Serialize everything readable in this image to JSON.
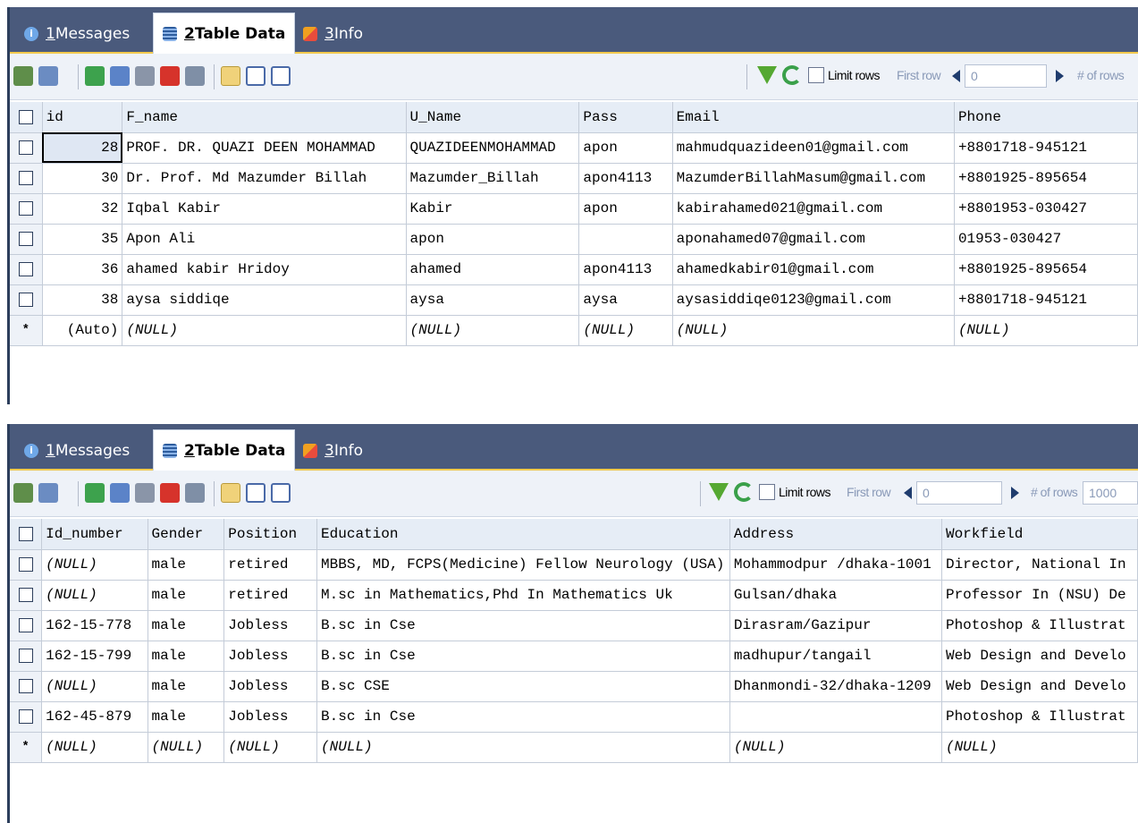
{
  "tabs": {
    "messages": {
      "num": "1",
      "label": " Messages"
    },
    "table_data": {
      "num": "2",
      "label": " Table Data"
    },
    "info": {
      "num": "3",
      "label": " Info"
    }
  },
  "toolbar": {
    "limit_rows_label": "Limit rows",
    "first_row_label": "First row",
    "first_row_value": "0",
    "num_rows_label": "# of rows",
    "num_rows_value": "1000"
  },
  "grid1": {
    "headers": [
      "id",
      "F_name",
      "U_Name",
      "Pass",
      "Email",
      "Phone"
    ],
    "rows": [
      [
        "28",
        "PROF. DR. QUAZI DEEN MOHAMMAD",
        "QUAZIDEENMOHAMMAD",
        "apon",
        "mahmudquazideen01@gmail.com",
        "+8801718-945121"
      ],
      [
        "30",
        "Dr. Prof. Md Mazumder Billah",
        "Mazumder_Billah",
        "apon4113",
        "MazumderBillahMasum@gmail.com",
        "+8801925-895654"
      ],
      [
        "32",
        "Iqbal Kabir",
        "Kabir",
        "apon",
        "kabirahamed021@gmail.com",
        "+8801953-030427"
      ],
      [
        "35",
        "Apon Ali",
        "apon",
        "",
        "aponahamed07@gmail.com",
        "01953-030427"
      ],
      [
        "36",
        "ahamed kabir Hridoy",
        "ahamed",
        "apon4113",
        "ahamedkabir01@gmail.com",
        "+8801925-895654"
      ],
      [
        "38",
        "aysa siddiqe",
        "aysa",
        "aysa",
        "aysasiddiqe0123@gmail.com",
        "+8801718-945121"
      ]
    ],
    "new_row": [
      "(Auto)",
      "(NULL)",
      "(NULL)",
      "(NULL)",
      "(NULL)",
      "(NULL)"
    ]
  },
  "grid2": {
    "headers": [
      "Id_number",
      "Gender",
      "Position",
      "Education",
      "Address",
      "Workfield"
    ],
    "rows": [
      [
        "(NULL)",
        "male",
        "retired",
        "MBBS, MD, FCPS(Medicine) Fellow Neurology (USA)",
        "Mohammodpur /dhaka-1001",
        "Director, National In"
      ],
      [
        "(NULL)",
        "male",
        "retired",
        "M.sc in Mathematics,Phd In Mathematics Uk",
        "Gulsan/dhaka",
        "Professor In (NSU) De"
      ],
      [
        "162-15-778",
        "male",
        "Jobless",
        "B.sc in Cse",
        "Dirasram/Gazipur",
        "Photoshop & Illustrat"
      ],
      [
        "162-15-799",
        "male",
        "Jobless",
        "B.sc in Cse",
        "madhupur/tangail",
        "Web Design and Develo"
      ],
      [
        "(NULL)",
        "male",
        "Jobless",
        "B.sc CSE",
        "Dhanmondi-32/dhaka-1209",
        "Web Design and Develo"
      ],
      [
        "162-45-879",
        "male",
        "Jobless",
        "B.sc in Cse",
        "",
        "Photoshop & Illustrat"
      ]
    ],
    "new_row": [
      "(NULL)",
      "(NULL)",
      "(NULL)",
      "(NULL)",
      "(NULL)",
      "(NULL)"
    ]
  },
  "new_row_marker": "*"
}
